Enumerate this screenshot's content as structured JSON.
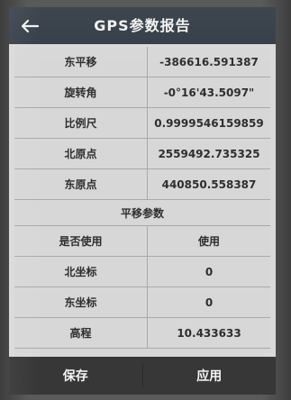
{
  "header": {
    "title": "GPS参数报告",
    "back_icon": "arrow-left-icon"
  },
  "parameters": [
    {
      "label": "东平移",
      "value": "-386616.591387"
    },
    {
      "label": "旋转角",
      "value": "-0°16'43.5097\""
    },
    {
      "label": "比例尺",
      "value": "0.9999546159859"
    },
    {
      "label": "北原点",
      "value": "2559492.735325"
    },
    {
      "label": "东原点",
      "value": "440850.558387"
    }
  ],
  "translation_section": {
    "title": "平移参数",
    "rows": [
      {
        "label": "是否使用",
        "value": "使用"
      },
      {
        "label": "北坐标",
        "value": "0"
      },
      {
        "label": "东坐标",
        "value": "0"
      },
      {
        "label": "高程",
        "value": "10.433633"
      }
    ]
  },
  "footer": {
    "save_label": "保存",
    "apply_label": "应用"
  }
}
